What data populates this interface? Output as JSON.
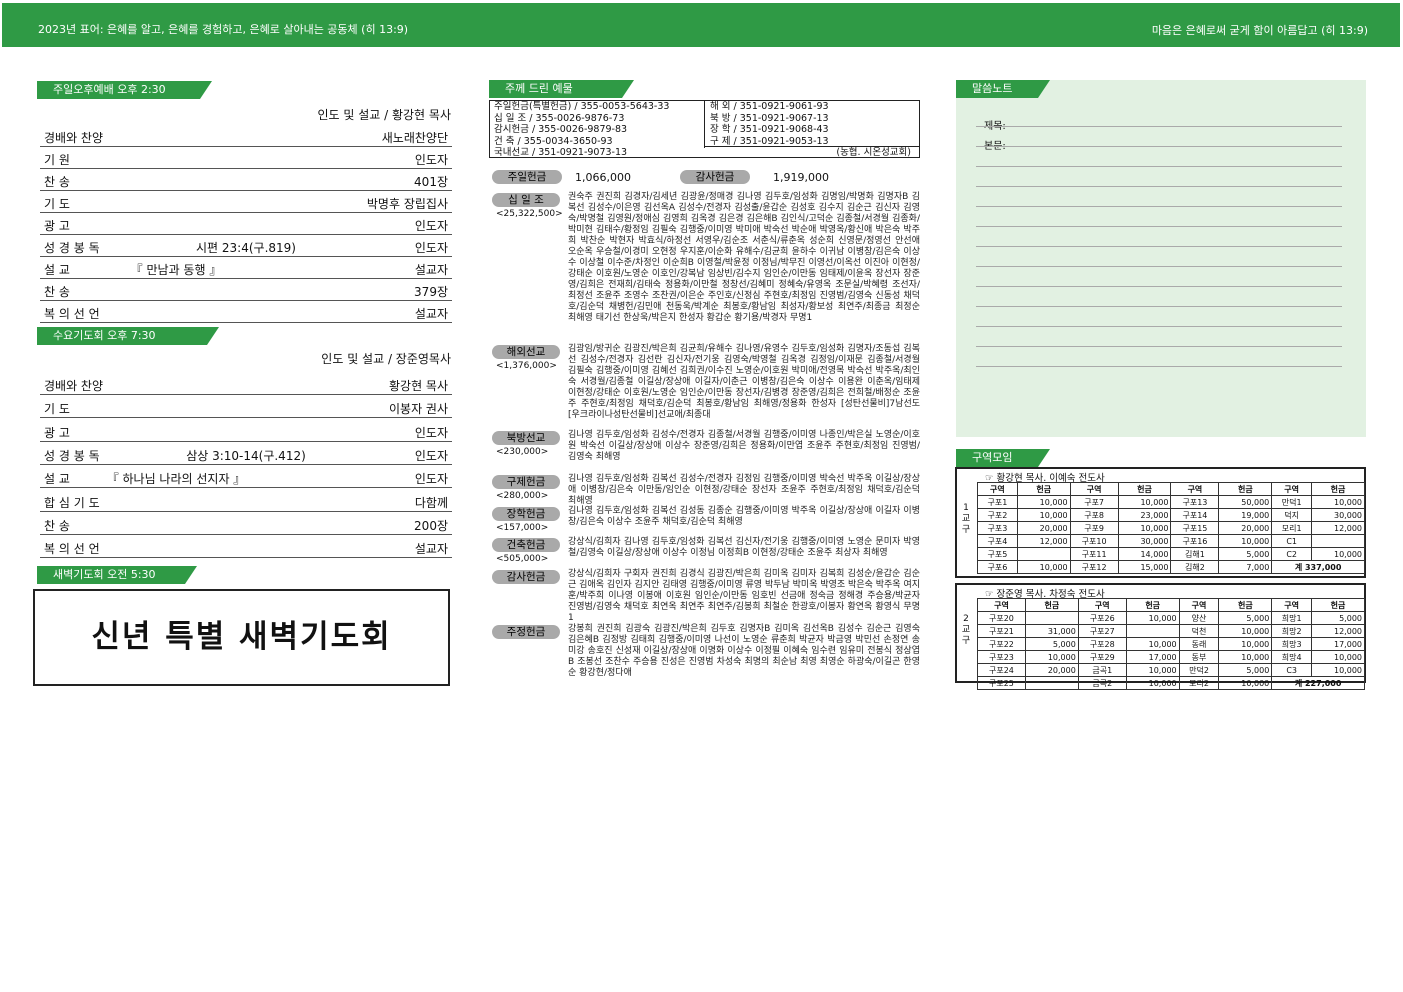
{
  "header": {
    "left": "2023년 표어: 은혜를 알고, 은혜를 경험하고, 은혜로 살아내는 공동체 (히 13:9)",
    "right": "마음은 은혜로써 굳게 함이 아름답고 (히 13:9)"
  },
  "sunday": {
    "tag": "주일오후예배  오후 2:30",
    "preach": "인도 및 설교 / 황강현 목사",
    "rows": [
      [
        "경배와 찬양",
        "",
        "새노래찬양단"
      ],
      [
        "기      원",
        "",
        "인도자"
      ],
      [
        "찬      송",
        "",
        "401장"
      ],
      [
        "기      도",
        "",
        "박명후 장립집사"
      ],
      [
        "광      고",
        "",
        "인도자"
      ],
      [
        "성 경 봉 독",
        "시편 23:4(구.819)",
        "인도자"
      ],
      [
        "설      교",
        "『 만남과 동행 』",
        "설교자"
      ],
      [
        "찬      송",
        "",
        "379장"
      ],
      [
        "복 의 선 언",
        "",
        "설교자"
      ]
    ]
  },
  "wednesday": {
    "tag": "수요기도회    오후 7:30",
    "preach": "인도 및 설교 / 장준영목사",
    "rows": [
      [
        "경배와 찬양",
        "",
        "황강현 목사"
      ],
      [
        "기      도",
        "",
        "이봉자 권사"
      ],
      [
        "광      고",
        "",
        "인도자"
      ],
      [
        "성 경 봉 독",
        "삼상 3:10-14(구.412)",
        "인도자"
      ],
      [
        "설      교",
        "『 하나님 나라의 선지자 』",
        "인도자"
      ],
      [
        "합 심 기 도",
        "",
        "다함께"
      ],
      [
        "찬      송",
        "",
        "200장"
      ],
      [
        "복 의 선 언",
        "",
        "설교자"
      ]
    ]
  },
  "dawn": {
    "tag": "새벽기도회  오전 5:30",
    "title": "신년  특별  새벽기도회"
  },
  "offering": {
    "tag": "주께 드린 예물",
    "accounts_left": [
      "주일헌금(특별헌금) / 355-0053-5643-33",
      "십 일 조 / 355-0026-9876-73",
      "감시헌금 / 355-0026-9879-83",
      "건       축 / 355-0034-3650-93",
      "국내선교 / 351-0921-9073-13"
    ],
    "accounts_right": [
      "해       외 / 351-0921-9061-93",
      "북       방 / 351-0921-9067-13",
      "장       학 / 351-0921-9068-43",
      "구       제 / 351-0921-9053-13"
    ],
    "bank": "(농협.  시온성교회)",
    "sunday_label": "주일헌금",
    "sunday_amount": "1,066,000",
    "thanks_label": "감사헌금",
    "thanks_amount": "1,919,000",
    "items": [
      {
        "label": "십 일 조",
        "sub": "<25,322,500>",
        "names": "권숙주 권진희 김경자/김세년 김광윤/정매경 김나영 김두호/임성화 김명임/박명화 김명자B 김복선 김성수/이은영 김선옥A 김성수/전경자 김성출/윤갑순 김성호 김수지 김순근 김신자 김영숙/박명철 김영원/정애심 김영희 김옥경 김은경 김은해B 김인식/고덕순 김종철/서경월 김종화/박미현 김태수/황정임 김필숙 김행중/이미영 박미애 박숙선 박순애 박영옥/황신애 박은숙 박주희 박찬순 박현자 박효식/하정선 서영우/김순조 서춘식/류춘옥 성순희 신영문/정영선 안선애 오순옥 우승철/이경미 오현정 우지훈/이순화 유해수/김균희 윤하수 이귀남 이병창/김은숙 이상수 이상철 이수준/차정인 이순희B 이영철/박윤정 이정님/박무진 이영선/이옥선 이진아 이현정/강태순 이호원/노영순 이호인/강복남 임상빈/김수지 임인순/이만동 임태제/이윤옥 장선자 장준영/김희은 전재희/김태숙 정용화/이만철 정창선/김혜미 정혜숙/유영옥 조문실/박혜령 조선자/최정선 조윤주 조영수 조찬권/이은순 주인호/신정심 주현호/최정임 진영범/김영숙 신동성 채덕호/김순덕 채병헌/김민애 천동욱/박계순 최봉호/황남임 최성자/황보성 최연주/최종금 최정순 최해영 태기선 한상욱/박은지 한성자 황갑순 황기용/박경자 무명1"
      },
      {
        "label": "해외선교",
        "sub": "<1,376,000>",
        "names": "김광임/방귀순 김광진/박은희 김균희/유해수 김나영/유영수 김두호/임성화 김명자/조동섭 김복선 김성수/전경자 김선란 김신자/전기웅 김영숙/박영철 김옥경 김정임/이재문 김종철/서경월 김필숙 김행중/이미영 김혜선 김희권/이수진 노영순/이호원 박미애/전영목 박숙선 박주옥/최인숙 서경월/김종철 이길상/장상애 이길자/이춘근 이병창/김은숙 이상수 이용완 이춘옥/임태제 이현정/강태순 이호원/노영순 임인순/이만동 장선자/김병경 장준영/김희은 전희철/배정순 조윤주 주현호/최정임 채덕호/김순덕 최봉호/황남임 최해영/정용화 한성자 [성탄선물비]7남선도 [우크라이나성탄선물비]선교애/최종대"
      },
      {
        "label": "북방선교",
        "sub": "<230,000>",
        "names": "김나영 김두호/임성화 김성수/전경자 김종철/서경월 김행중/이미영 나종인/박은실 노영순/이호원 박숙선 이길상/장상애 이상수 장준영/김희은 정용화/이만엽 조윤주 주현호/최정임 진영범/김영숙 최해영"
      },
      {
        "label": "구제헌금",
        "sub": "<280,000>",
        "names": "김나영 김두호/임성화 김복선 김성수/전경자 김정임 김행중/이미영 박숙선 박주옥 이길상/장상애 이병창/김은숙 이만동/임인순 이현정/강태순 장선자 조윤주 주현호/최정임 채덕호/김순덕 최해영"
      },
      {
        "label": "장학헌금",
        "sub": "<157,000>",
        "names": "김나영 김두호/임성화 김복선 김성동 김종순 김행중/이미영 박주옥 이길상/장상애 이길자 이병창/김은숙 이상수 조윤주 채덕호/김순덕 최해영"
      },
      {
        "label": "건축헌금",
        "sub": "<505,000>",
        "names": "강상식/김희자 김나영 김두호/임성화 김복선 김신자/전기웅 김행중/이미영 노영순 문미자 박영철/김영숙 이길상/장상애 이상수 이정님 이정희B 이현정/강태순 조윤주 최상자 최해영"
      },
      {
        "label": "감사헌금",
        "sub": "",
        "names": "강상식/김희자 구회자 권진희 김경식 김광진/박은희 김미옥 김미자 김복희 김성순/윤갑순 김순근 김애옥 김인자 김지안 김태영 김행중/이미영 류영 박두남 박미옥 박영조 박은숙 박주옥 여지훈/박주희 이나영 이봉애 이호원 임인순/이만동 임호빈 선금애 정숙금 정해경 주승용/박균자 진영범/김영숙 채덕호 최연옥 최연주 최연주/김봉희 최철순 한광호/이봉자 황연옥 황영식 무명1"
      },
      {
        "label": "주정헌금",
        "sub": "",
        "names": "강봉희 권진희 김광숙 김광진/박은희 김두호 김명자B 김미옥 김선옥B 김성수 김순근 김영숙 김은혜B 김정방 김태희 김행중/이미영 나선이 노영순 류춘희 박균자 박금영 박민선 손정연 송미강 송호진 신성재 이길상/장상애 이명화 이상수 이정필 이혜숙 임수련 임유미 전봉식 정상엽B 조봉선 조찬수 주승용 진성은 진영범 차성숙 최명의 최순남 최영 최영순 하광숙/이길곤 한영순 황강현/정다애"
      }
    ]
  },
  "notes": {
    "tag": "말씀노트",
    "title_label": "제목:",
    "body_label": "본문:"
  },
  "groups": {
    "tag": "구역모임",
    "g1": {
      "pastor": "☞  황강현 목사. 이예숙 전도사",
      "vlabel": "1 교 구",
      "header": [
        "구역",
        "헌금",
        "구역",
        "헌금",
        "구역",
        "헌금",
        "구역",
        "헌금"
      ],
      "rows": [
        [
          "구포1",
          "10,000",
          "구포7",
          "10,000",
          "구포13",
          "50,000",
          "만덕1",
          "10,000"
        ],
        [
          "구포2",
          "10,000",
          "구포8",
          "23,000",
          "구포14",
          "19,000",
          "덕지",
          "30,000"
        ],
        [
          "구포3",
          "20,000",
          "구포9",
          "10,000",
          "구포15",
          "20,000",
          "모리1",
          "12,000"
        ],
        [
          "구포4",
          "12,000",
          "구포10",
          "30,000",
          "구포16",
          "10,000",
          "C1",
          ""
        ],
        [
          "구포5",
          "",
          "구포11",
          "14,000",
          "김해1",
          "5,000",
          "C2",
          "10,000"
        ],
        [
          "구포6",
          "10,000",
          "구포12",
          "15,000",
          "김해2",
          "7,000",
          "계  337,000",
          ""
        ]
      ]
    },
    "g2": {
      "pastor": "☞  장준영 목사. 차정숙 전도사",
      "vlabel": "2 교 구",
      "header": [
        "구역",
        "헌금",
        "구역",
        "헌금",
        "구역",
        "헌금",
        "구역",
        "헌금"
      ],
      "rows": [
        [
          "구포20",
          "",
          "구포26",
          "10,000",
          "양산",
          "5,000",
          "희망1",
          "5,000"
        ],
        [
          "구포21",
          "31,000",
          "구포27",
          "",
          "덕천",
          "10,000",
          "희망2",
          "12,000"
        ],
        [
          "구포22",
          "5,000",
          "구포28",
          "10,000",
          "동래",
          "10,000",
          "희망3",
          "17,000"
        ],
        [
          "구포23",
          "10,000",
          "구포29",
          "17,000",
          "동부",
          "10,000",
          "희망4",
          "10,000"
        ],
        [
          "구포24",
          "20,000",
          "금곡1",
          "10,000",
          "만덕2",
          "5,000",
          "C3",
          "10,000"
        ],
        [
          "구포25",
          "",
          "금곡2",
          "10,000",
          "모리2",
          "10,000",
          "계  227,000",
          ""
        ]
      ]
    }
  }
}
